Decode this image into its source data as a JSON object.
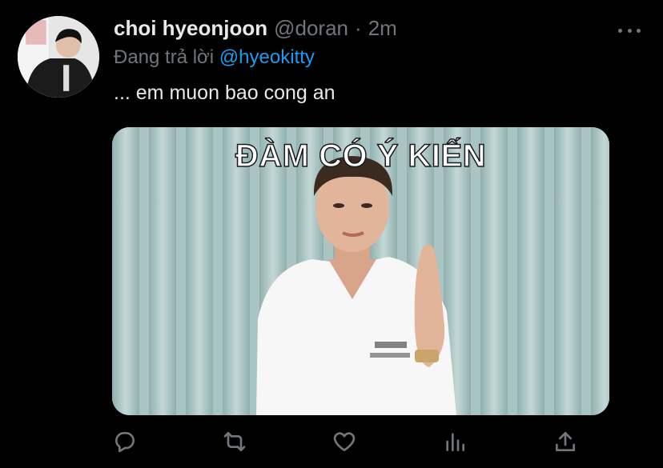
{
  "tweet": {
    "display_name": "choi hyeonjoon",
    "handle": "@doran",
    "separator": "·",
    "time": "2m",
    "reply_prefix": "Đang trả lời",
    "reply_to": "@hyeokitty",
    "text": "... em muon bao cong an"
  },
  "media": {
    "caption": "ĐÀM CÓ Ý KIẾN"
  },
  "actions": [
    "reply-icon",
    "retweet-icon",
    "like-icon",
    "analytics-icon",
    "share-icon"
  ],
  "colors": {
    "background": "#000000",
    "text": "#e7e9ea",
    "muted": "#71767b",
    "link": "#1d9bf0"
  }
}
